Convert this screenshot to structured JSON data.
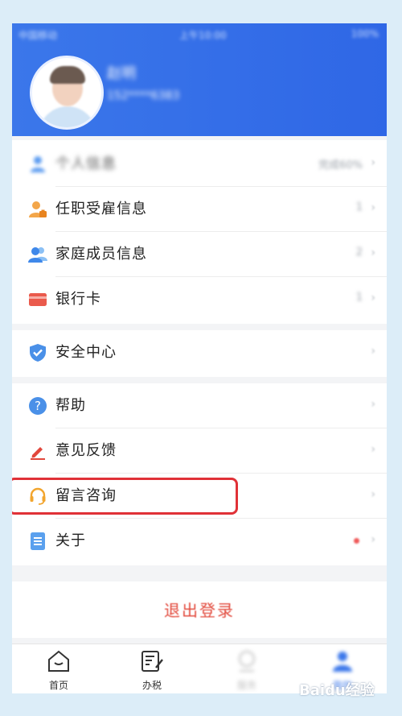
{
  "status": {
    "left": "中国移动",
    "time": "上午10:00",
    "right": "100%"
  },
  "profile": {
    "name": "赵明",
    "phone": "152****6383"
  },
  "menu_group1": [
    {
      "label": "个人信息",
      "value": "完成60%",
      "icon": "user-icon",
      "blurred": true
    },
    {
      "label": "任职受雇信息",
      "value": "1",
      "icon": "employment-icon"
    },
    {
      "label": "家庭成员信息",
      "value": "2",
      "icon": "family-icon"
    },
    {
      "label": "银行卡",
      "value": "1",
      "icon": "bank-card-icon"
    }
  ],
  "menu_group2": [
    {
      "label": "安全中心",
      "icon": "shield-icon"
    }
  ],
  "menu_group3": [
    {
      "label": "帮助",
      "icon": "question-icon"
    },
    {
      "label": "意见反馈",
      "icon": "pen-icon"
    },
    {
      "label": "留言咨询",
      "icon": "headset-icon"
    },
    {
      "label": "关于",
      "icon": "document-icon"
    }
  ],
  "logout_label": "退出登录",
  "tabs": [
    {
      "label": "首页",
      "icon": "home-icon"
    },
    {
      "label": "办税",
      "icon": "tax-icon"
    },
    {
      "label": "服务",
      "icon": "service-icon"
    },
    {
      "label": "我的",
      "icon": "me-icon"
    }
  ],
  "watermark": "Baidu经验",
  "colors": {
    "header": "#3b77ea",
    "logout": "#e24a3d",
    "highlight": "#e03137"
  }
}
